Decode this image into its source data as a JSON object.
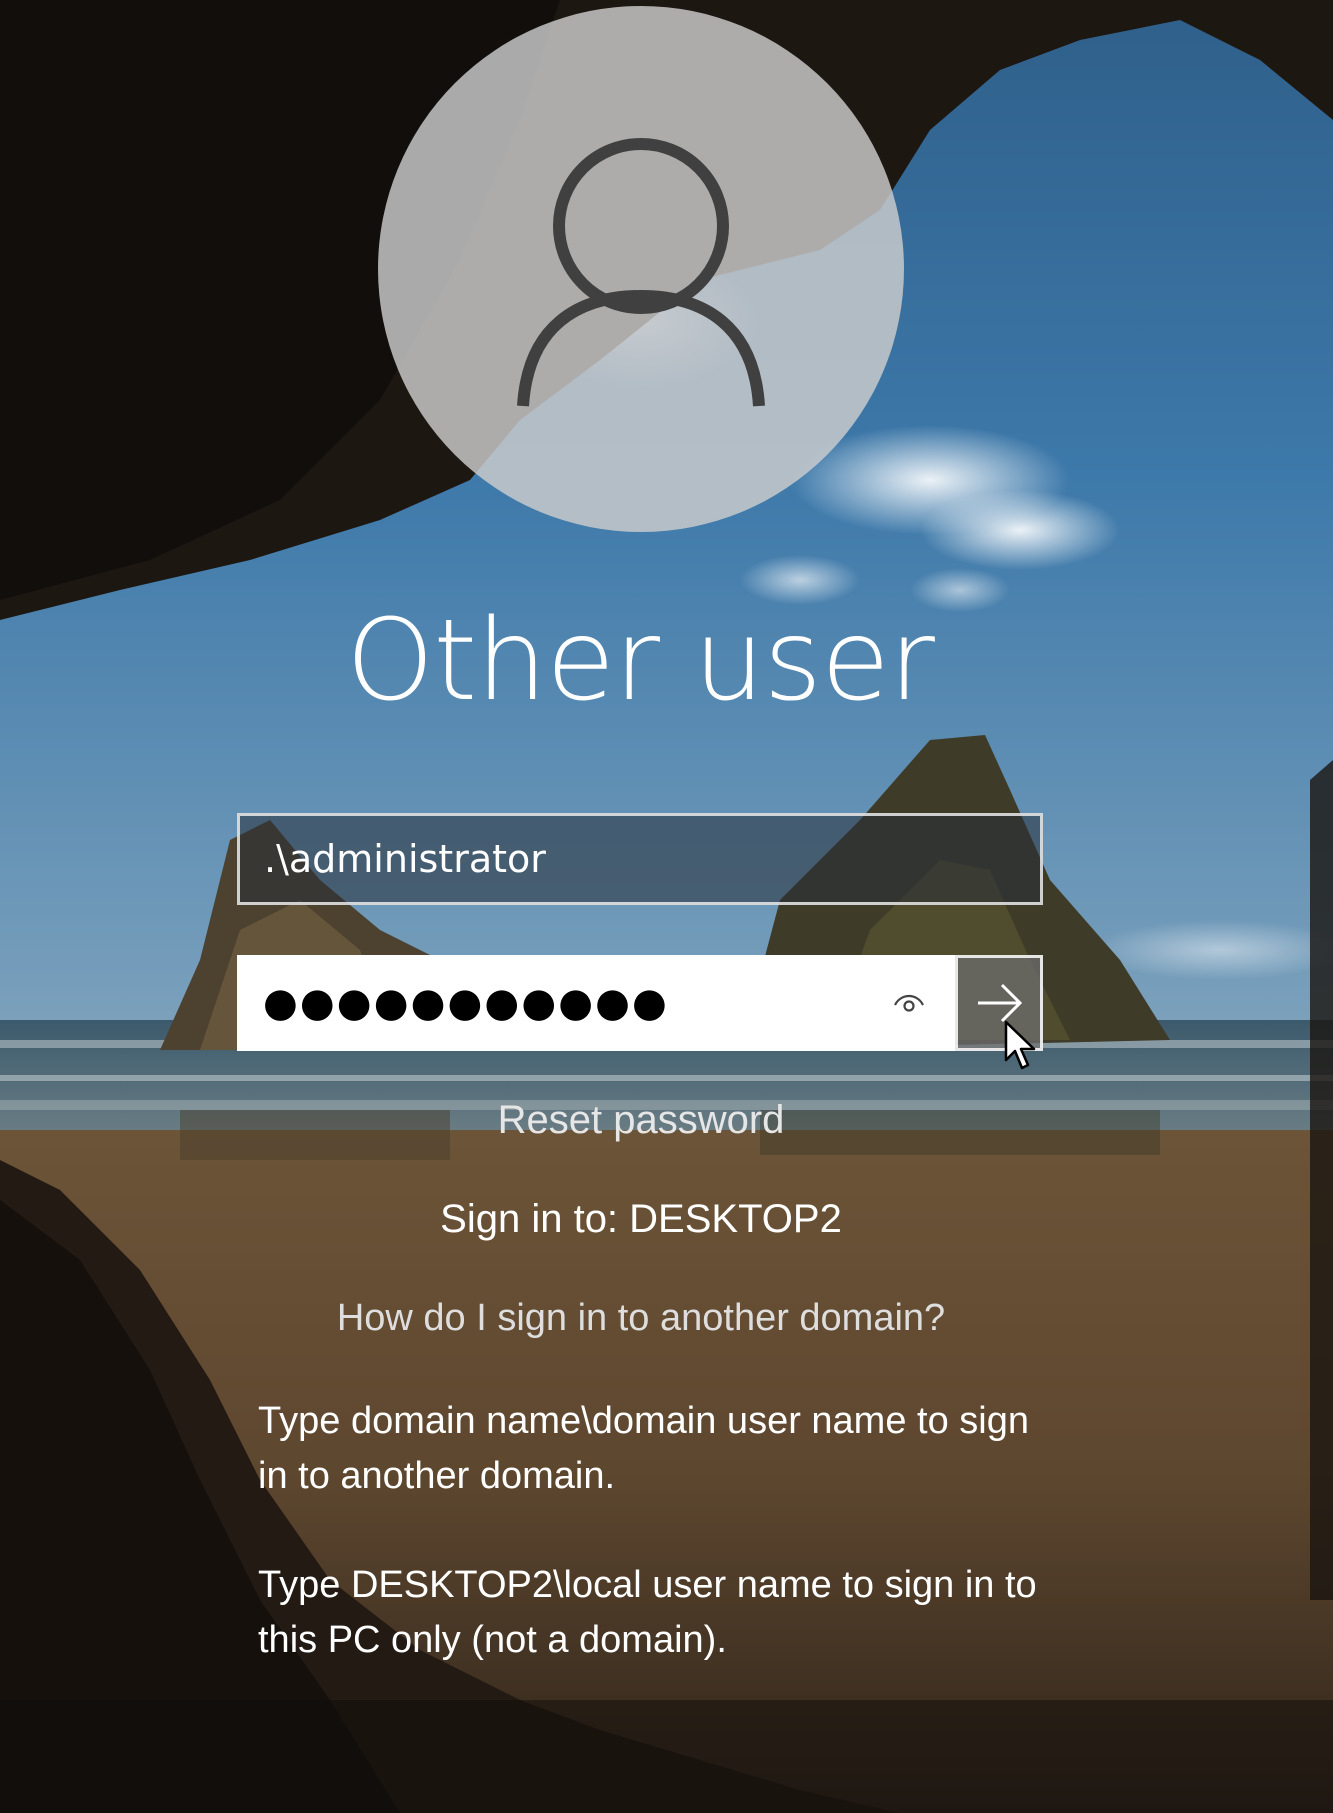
{
  "login": {
    "username_display": "Other user",
    "username_value": ".\\administrator",
    "password_mask": "●●●●●●●●●●●",
    "reset_password": "Reset password",
    "sign_in_to": "Sign in to: DESKTOP2",
    "other_domain_link": "How do I sign in to another domain?",
    "help_domain": "Type domain name\\domain user name to sign in to another domain.",
    "help_local": "Type DESKTOP2\\local user name to sign in to this PC only (not a domain)."
  },
  "icons": {
    "avatar": "user-silhouette-icon",
    "reveal": "eye-icon",
    "submit": "arrow-right-icon",
    "cursor": "mouse-pointer-icon"
  },
  "colors": {
    "text": "#ffffff",
    "field_border": "#ebebeb",
    "avatar_bg": "#cdcdcd"
  }
}
